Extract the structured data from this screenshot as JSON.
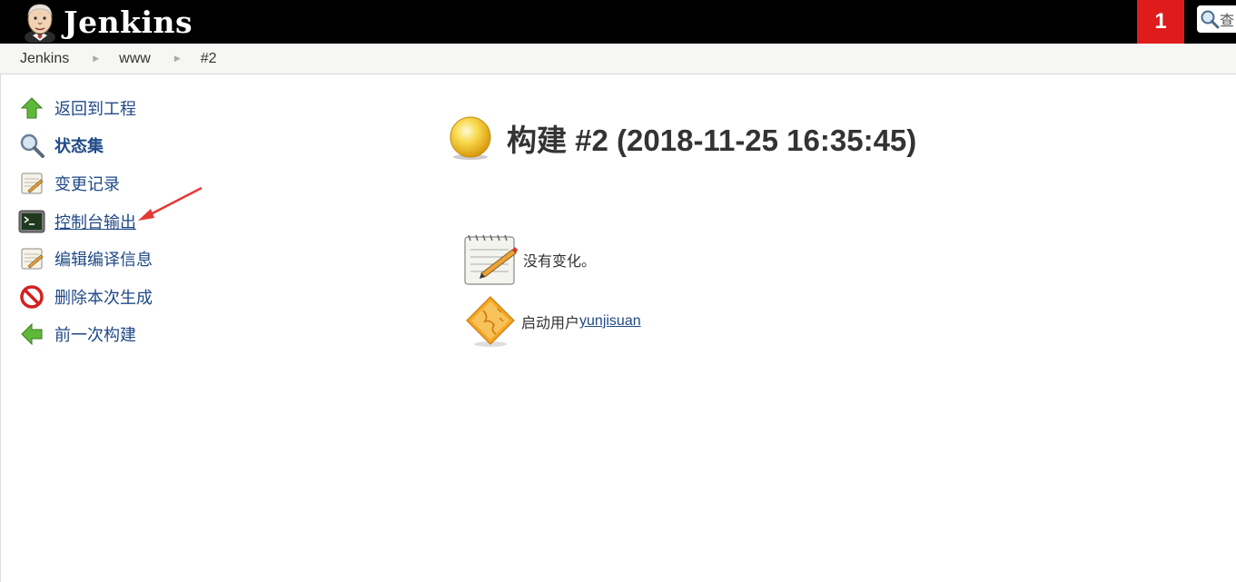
{
  "header": {
    "logo_text": "Jenkins",
    "notification_count": "1",
    "search_placeholder": "查"
  },
  "breadcrumbs": [
    "Jenkins",
    "www",
    "#2"
  ],
  "sidebar": {
    "items": [
      {
        "label": "返回到工程",
        "icon": "up-arrow-icon"
      },
      {
        "label": "状态集",
        "icon": "search-icon"
      },
      {
        "label": "变更记录",
        "icon": "notepad-icon"
      },
      {
        "label": "控制台输出",
        "icon": "terminal-icon"
      },
      {
        "label": "编辑编译信息",
        "icon": "notepad-icon"
      },
      {
        "label": "删除本次生成",
        "icon": "no-entry-icon"
      },
      {
        "label": "前一次构建",
        "icon": "back-arrow-icon"
      }
    ]
  },
  "main": {
    "title": "构建 #2 (2018-11-25 16:35:45)",
    "status_color": "#f0c419",
    "changes_text": "没有变化。",
    "started_by_prefix": "启动用户",
    "started_by_user": "yunjisuan"
  },
  "colors": {
    "header_bg": "#000000",
    "notification_bg": "#e01b1b",
    "link": "#204a87",
    "annotation_arrow": "#e53935"
  }
}
